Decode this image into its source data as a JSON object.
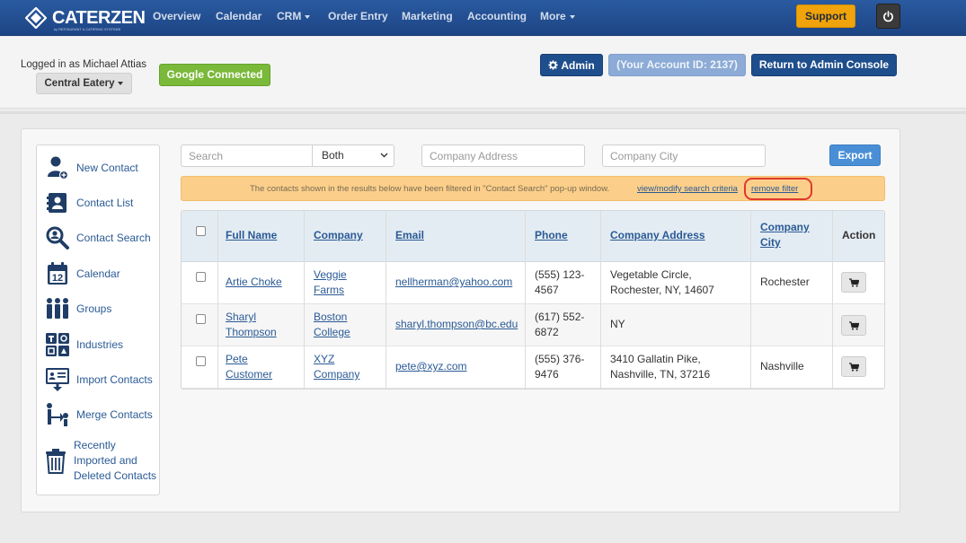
{
  "brand": {
    "name": "CATERZEN",
    "tagline": "by RESTAURANT & CATERING SYSTEMS"
  },
  "nav": {
    "items": [
      {
        "label": "Overview",
        "dropdown": false
      },
      {
        "label": "Calendar",
        "dropdown": false
      },
      {
        "label": "CRM",
        "dropdown": true
      },
      {
        "label": "Order Entry",
        "dropdown": false
      },
      {
        "label": "Marketing",
        "dropdown": false
      },
      {
        "label": "Accounting",
        "dropdown": false
      },
      {
        "label": "More",
        "dropdown": true
      }
    ],
    "support_label": "Support"
  },
  "header": {
    "logged_in": "Logged in as Michael Attias",
    "location": "Central Eatery",
    "google_status": "Google Connected",
    "admin_label": "Admin",
    "account_id": "(Your Account ID: 2137)",
    "console_label": "Return to Admin Console"
  },
  "sidebar": {
    "items": [
      {
        "label": "New Contact",
        "icon": "new-contact-icon"
      },
      {
        "label": "Contact List",
        "icon": "contact-list-icon"
      },
      {
        "label": "Contact Search",
        "icon": "search-icon"
      },
      {
        "label": "Calendar",
        "icon": "calendar-icon"
      },
      {
        "label": "Groups",
        "icon": "groups-icon"
      },
      {
        "label": "Industries",
        "icon": "industries-icon"
      },
      {
        "label": "Import Contacts",
        "icon": "import-icon"
      },
      {
        "label": "Merge Contacts",
        "icon": "merge-icon"
      },
      {
        "label": "Recently Imported and Deleted Contacts",
        "line1": "Recently",
        "line2": "Imported and",
        "line3": "Deleted Contacts",
        "icon": "trash-icon"
      }
    ]
  },
  "filters": {
    "search_placeholder": "Search",
    "scope_value": "Both",
    "address_placeholder": "Company Address",
    "city_placeholder": "Company City",
    "export_label": "Export"
  },
  "banner": {
    "text": "The contacts shown in the results below have been filtered in \"Contact Search\" pop-up window.",
    "modify_link": "view/modify search criteria",
    "remove_link": "remove filter"
  },
  "table": {
    "headers": {
      "name": "Full Name",
      "company": "Company",
      "email": "Email",
      "phone": "Phone",
      "address": "Company Address",
      "city_line1": "Company",
      "city_line2": "City",
      "action": "Action"
    },
    "rows": [
      {
        "name_line1": "Artie Choke",
        "name_line2": "",
        "company_line1": "Veggie",
        "company_line2": "Farms",
        "email": "nellherman@yahoo.com",
        "phone_line1": "(555) 123-",
        "phone_line2": "4567",
        "address_line1": "Vegetable Circle,",
        "address_line2": "Rochester, NY, 14607",
        "city": "Rochester"
      },
      {
        "name_line1": "Sharyl",
        "name_line2": "Thompson",
        "company_line1": "Boston",
        "company_line2": "College",
        "email": "sharyl.thompson@bc.edu",
        "phone_line1": "(617) 552-",
        "phone_line2": "6872",
        "address_line1": "NY",
        "address_line2": "",
        "city": ""
      },
      {
        "name_line1": "Pete",
        "name_line2": "Customer",
        "company_line1": "XYZ",
        "company_line2": "Company",
        "email": "pete@xyz.com",
        "phone_line1": "(555) 376-",
        "phone_line2": "9476",
        "address_line1": "3410 Gallatin Pike,",
        "address_line2": "Nashville, TN, 37216",
        "city": "Nashville"
      }
    ]
  },
  "colors": {
    "nav_bg": "#204a87",
    "support": "#f0a30a",
    "google": "#7ab93a",
    "primary": "#1f4e8c",
    "banner": "#fbcf8a",
    "highlight": "#e0392d",
    "link": "#2a5a95"
  }
}
